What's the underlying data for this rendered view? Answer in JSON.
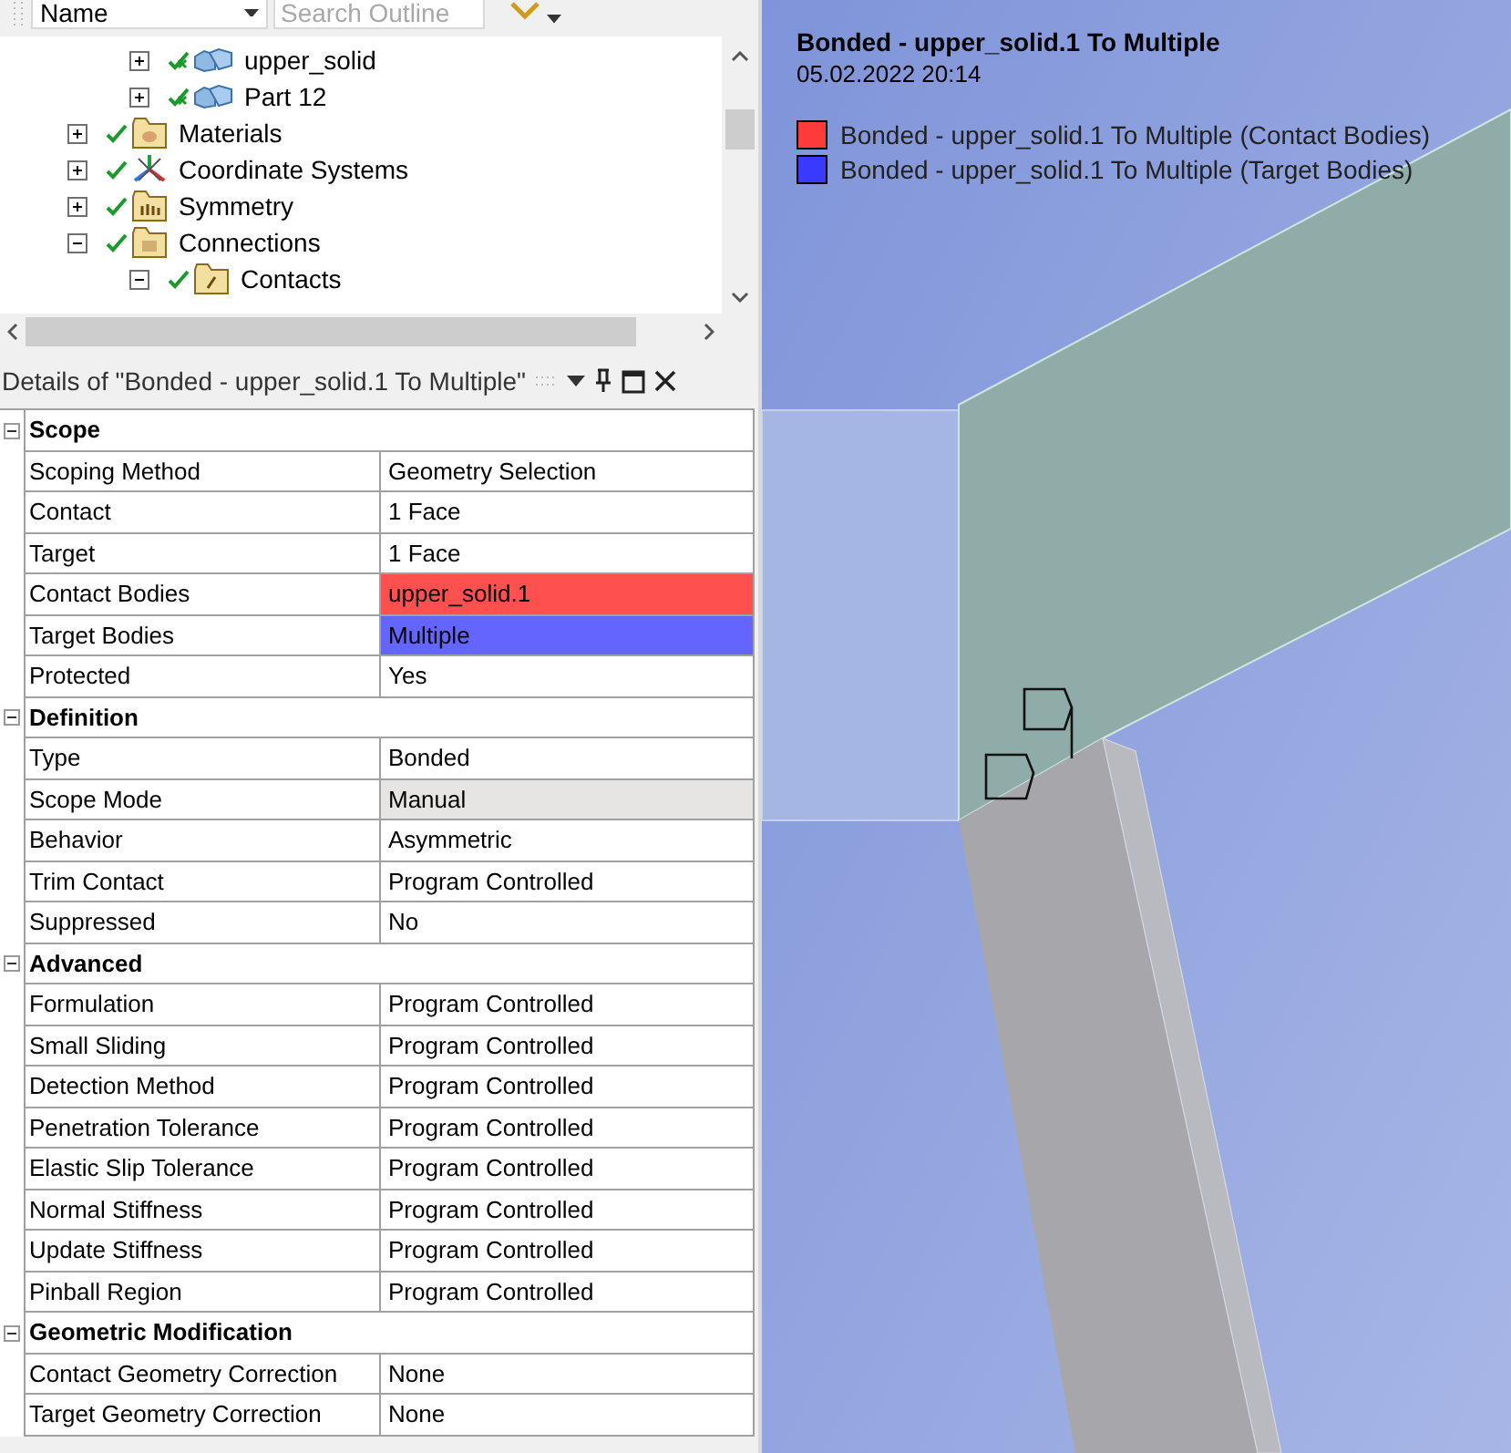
{
  "outline_toolbar": {
    "column_select": {
      "value": "Name"
    },
    "search": {
      "placeholder": "Search Outline"
    }
  },
  "tree": {
    "items": [
      {
        "children": [
          {
            "label": "upper_solid",
            "kind": "body",
            "meshed": true,
            "expanded": false
          },
          {
            "label": "Part 12",
            "kind": "body",
            "meshed": true,
            "expanded": false
          }
        ]
      },
      {
        "label": "Materials",
        "kind": "materials",
        "meshed": false,
        "expanded": false
      },
      {
        "label": "Coordinate Systems",
        "kind": "coordinates",
        "meshed": false,
        "expanded": false
      },
      {
        "label": "Symmetry",
        "kind": "symmetry",
        "meshed": false,
        "expanded": false
      },
      {
        "label": "Connections",
        "kind": "connections",
        "meshed": false,
        "expanded": true,
        "children": [
          {
            "label": "Contacts",
            "kind": "contacts",
            "meshed": false,
            "expanded": true
          }
        ]
      }
    ]
  },
  "details": {
    "title": "Details of \"Bonded - upper_solid.1 To Multiple\"",
    "groups": [
      {
        "label": "Scope",
        "expanded": true,
        "rows": [
          {
            "name": "Scoping Method",
            "value": "Geometry Selection",
            "read_only": false
          },
          {
            "name": "Contact",
            "value": "1 Face",
            "read_only": false
          },
          {
            "name": "Target",
            "value": "1 Face",
            "read_only": false
          },
          {
            "name": "Contact Bodies",
            "value": "upper_solid.1",
            "read_only": false,
            "color": "#ff5050"
          },
          {
            "name": "Target Bodies",
            "value": "Multiple",
            "read_only": false,
            "color": "#6464ff"
          },
          {
            "name": "Protected",
            "value": "Yes",
            "read_only": false
          }
        ]
      },
      {
        "label": "Definition",
        "expanded": true,
        "rows": [
          {
            "name": "Type",
            "value": "Bonded",
            "read_only": false
          },
          {
            "name": "Scope Mode",
            "value": "Manual",
            "read_only": true
          },
          {
            "name": "Behavior",
            "value": "Asymmetric",
            "read_only": false
          },
          {
            "name": "Trim Contact",
            "value": "Program Controlled",
            "read_only": false
          },
          {
            "name": "Suppressed",
            "value": "No",
            "read_only": false
          }
        ]
      },
      {
        "label": "Advanced",
        "expanded": true,
        "rows": [
          {
            "name": "Formulation",
            "value": "Program Controlled",
            "read_only": false
          },
          {
            "name": "Small Sliding",
            "value": "Program Controlled",
            "read_only": false
          },
          {
            "name": "Detection Method",
            "value": "Program Controlled",
            "read_only": false
          },
          {
            "name": "Penetration Tolerance",
            "value": "Program Controlled",
            "read_only": false
          },
          {
            "name": "Elastic Slip Tolerance",
            "value": "Program Controlled",
            "read_only": false
          },
          {
            "name": "Normal Stiffness",
            "value": "Program Controlled",
            "read_only": false
          },
          {
            "name": "Update Stiffness",
            "value": "Program Controlled",
            "read_only": false
          },
          {
            "name": "Pinball Region",
            "value": "Program Controlled",
            "read_only": false
          }
        ]
      },
      {
        "label": "Geometric Modification",
        "expanded": true,
        "rows": [
          {
            "name": "Contact Geometry Correction",
            "value": "None",
            "read_only": false
          },
          {
            "name": "Target Geometry Correction",
            "value": "None",
            "read_only": false
          }
        ]
      }
    ]
  },
  "viewport": {
    "title": "Bonded - upper_solid.1 To Multiple",
    "timestamp": "05.02.2022 20:14",
    "legend": [
      {
        "label": "Bonded - upper_solid.1 To Multiple (Contact Bodies)",
        "color": "#ff3a3a"
      },
      {
        "label": "Bonded - upper_solid.1 To Multiple (Target Bodies)",
        "color": "#3a3aff"
      }
    ]
  }
}
